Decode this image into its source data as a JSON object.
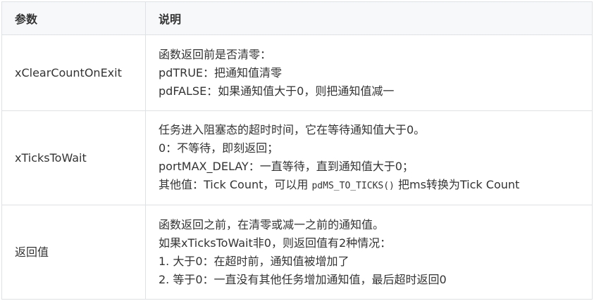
{
  "header": {
    "param": "参数",
    "desc": "说明"
  },
  "rows": [
    {
      "param": "xClearCountOnExit",
      "lines": [
        "函数返回前是否清零：",
        "pdTRUE：把通知值清零",
        "pdFALSE：如果通知值大于0，则把通知值减一"
      ]
    },
    {
      "param": "xTicksToWait",
      "lines": [
        "任务进入阻塞态的超时时间，它在等待通知值大于0。",
        "0：不等待，即刻返回；",
        "portMAX_DELAY：一直等待，直到通知值大于0；"
      ],
      "last_line": {
        "before": "其他值：Tick Count，可以用 ",
        "code": "pdMS_TO_TICKS()",
        "after": " 把ms转换为Tick Count"
      }
    },
    {
      "param": "返回值",
      "lines": [
        "函数返回之前，在清零或减一之前的通知值。",
        "如果xTicksToWait非0，则返回值有2种情况：",
        "1. 大于0：在超时前，通知值被增加了",
        "2. 等于0：一直没有其他任务增加通知值，最后超时返回0"
      ]
    }
  ]
}
